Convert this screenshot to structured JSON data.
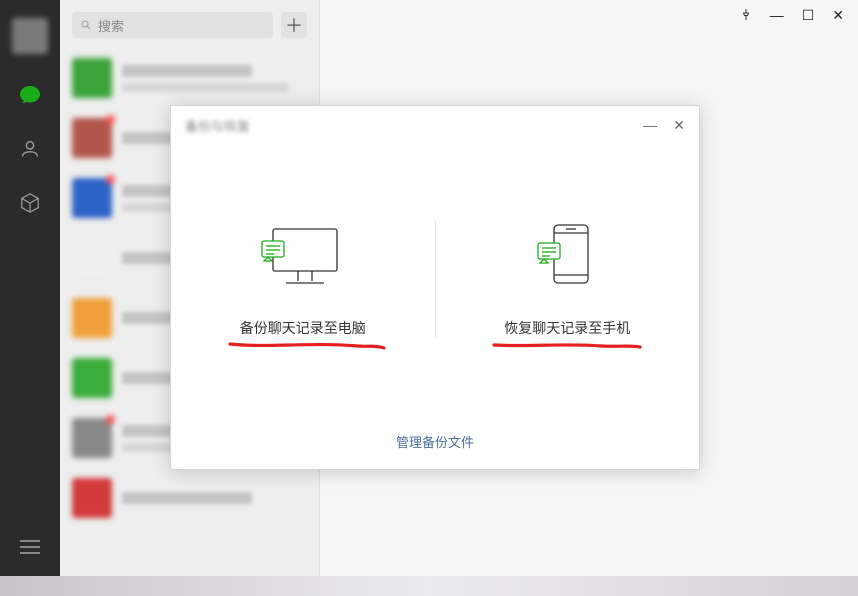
{
  "window": {
    "pin": "⇱",
    "minimize": "—",
    "maximize": "☐",
    "close": "✕"
  },
  "search": {
    "placeholder": "搜索"
  },
  "rail": {
    "chat": "chat",
    "contacts": "contacts",
    "collect": "collect"
  },
  "chats": [
    {
      "color": "#3ba33b",
      "badge": false
    },
    {
      "color": "#b2554a",
      "badge": true
    },
    {
      "color": "#2d62c7",
      "badge": true
    },
    {
      "color": "#efefef",
      "badge": false
    },
    {
      "color": "#f0a03a",
      "badge": false
    },
    {
      "color": "#3aad3a",
      "badge": false
    },
    {
      "color": "#888888",
      "badge": true
    },
    {
      "color": "#d23a3a",
      "badge": false
    }
  ],
  "dialog": {
    "title": "备份与恢复",
    "backup_label": "备份聊天记录至电脑",
    "restore_label": "恢复聊天记录至手机",
    "manage_link": "管理备份文件",
    "minimize": "—",
    "close": "✕"
  }
}
